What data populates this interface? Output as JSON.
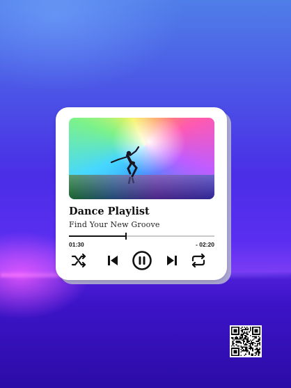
{
  "player": {
    "title": "Dance Playlist",
    "subtitle": "Find Your New Groove",
    "progress_fraction": 0.39,
    "time_current": "01:30",
    "time_remaining": "- 02:20"
  },
  "controls": {
    "shuffle_icon": "shuffle-icon",
    "previous_icon": "skip-previous-icon",
    "pause_icon": "pause-circle-icon",
    "next_icon": "skip-next-icon",
    "repeat_icon": "repeat-icon"
  },
  "colors": {
    "card_bg": "#ffffff",
    "text": "#111111",
    "track": "#c9c9c9"
  }
}
